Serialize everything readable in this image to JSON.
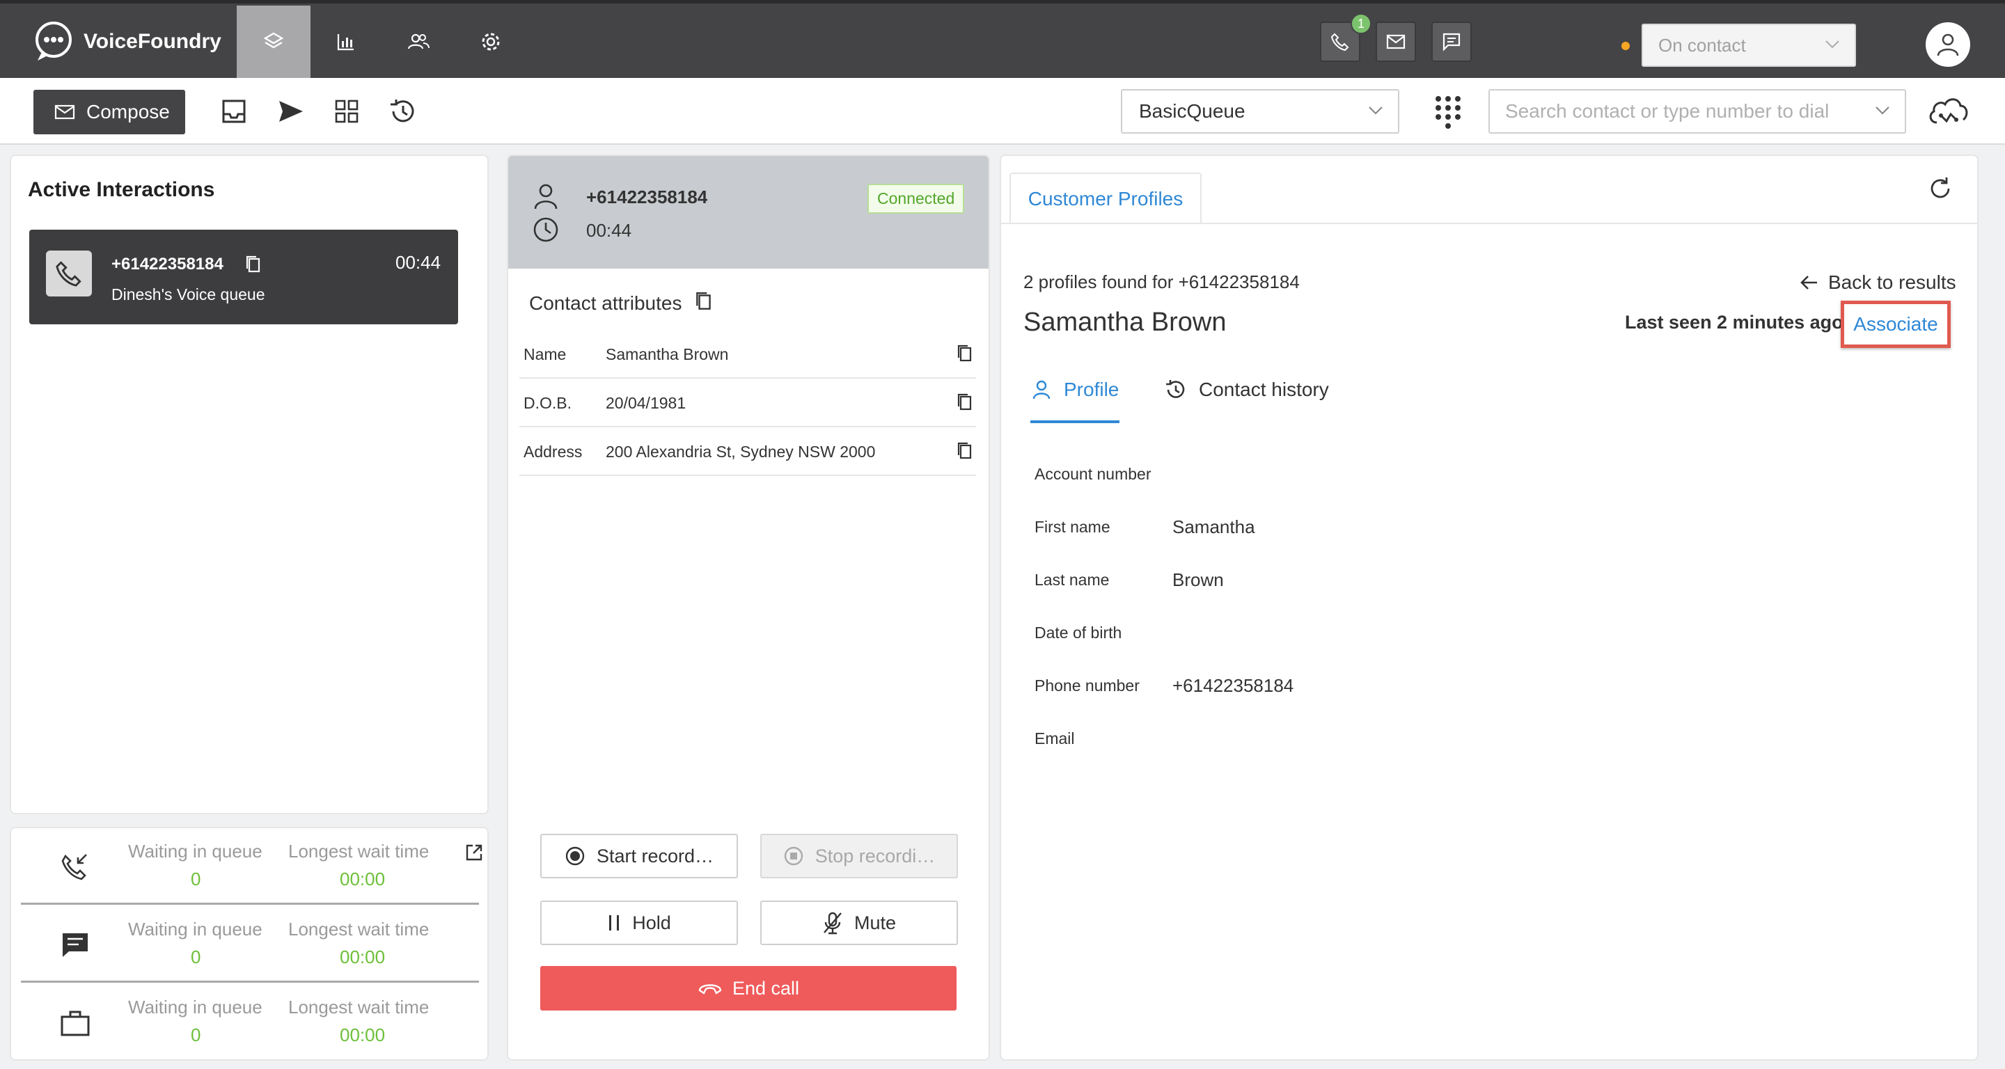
{
  "app": {
    "name": "VoiceFoundry",
    "notification_count": "1",
    "status": "On contact"
  },
  "toolbar": {
    "compose_label": "Compose",
    "queue_selected": "BasicQueue",
    "search_placeholder": "Search contact or type number to dial"
  },
  "active_interactions": {
    "title": "Active Interactions",
    "card": {
      "number": "+61422358184",
      "queue": "Dinesh's Voice queue",
      "duration": "00:44"
    }
  },
  "queue_stats": [
    {
      "icon": "incoming-call-icon",
      "waiting_label": "Waiting in queue",
      "waiting_value": "0",
      "wait_label": "Longest wait time",
      "wait_value": "00:00"
    },
    {
      "icon": "chat-icon",
      "waiting_label": "Waiting in queue",
      "waiting_value": "0",
      "wait_label": "Longest wait time",
      "wait_value": "00:00"
    },
    {
      "icon": "briefcase-icon",
      "waiting_label": "Waiting in queue",
      "waiting_value": "0",
      "wait_label": "Longest wait time",
      "wait_value": "00:00"
    }
  ],
  "call": {
    "number": "+61422358184",
    "duration": "00:44",
    "status": "Connected",
    "contact_attributes_title": "Contact attributes",
    "attributes": [
      {
        "key": "Name",
        "value": "Samantha Brown"
      },
      {
        "key": "D.O.B.",
        "value": "20/04/1981"
      },
      {
        "key": "Address",
        "value": "200 Alexandria St, Sydney NSW 2000"
      }
    ],
    "buttons": {
      "start_recording": "Start record…",
      "stop_recording": "Stop recordi…",
      "hold": "Hold",
      "mute": "Mute",
      "end_call": "End call"
    }
  },
  "customer_profiles": {
    "tab_label": "Customer Profiles",
    "found_text": "2 profiles found for +61422358184",
    "back_label": "Back to results",
    "name": "Samantha Brown",
    "last_seen": "Last seen 2 minutes ago",
    "associate_label": "Associate",
    "tabs": {
      "profile": "Profile",
      "history": "Contact history"
    },
    "fields": [
      {
        "key": "Account number",
        "value": ""
      },
      {
        "key": "First name",
        "value": "Samantha"
      },
      {
        "key": "Last name",
        "value": "Brown"
      },
      {
        "key": "Date of birth",
        "value": ""
      },
      {
        "key": "Phone number",
        "value": "+61422358184"
      },
      {
        "key": "Email",
        "value": ""
      }
    ]
  },
  "colors": {
    "topbar": "#444446",
    "accent_blue": "#2f88d6",
    "success_green": "#6dc03a",
    "danger_red": "#ef5a5a",
    "status_amber": "#f5a623"
  }
}
